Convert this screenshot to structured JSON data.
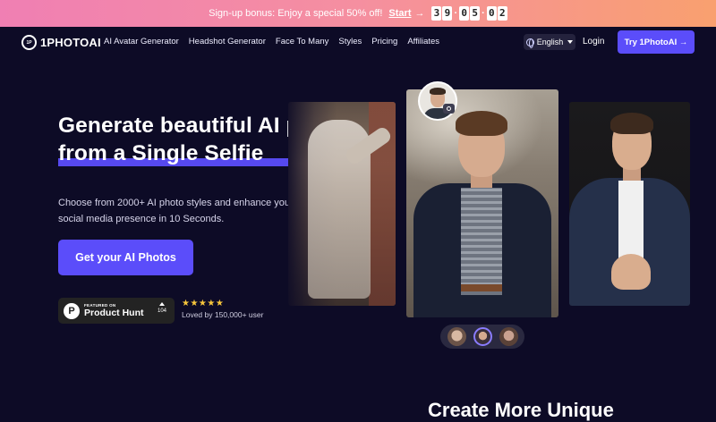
{
  "promo": {
    "text": "Sign-up bonus: Enjoy a special 50% off!",
    "link": "Start",
    "arrow": "→",
    "timer": [
      "3",
      "9",
      "0",
      "5",
      "0",
      "2"
    ]
  },
  "nav": {
    "logo_badge": "1P",
    "logo_text": "1PHOTOAI",
    "links": [
      "AI Avatar Generator",
      "Headshot Generator",
      "Face To Many",
      "Styles",
      "Pricing",
      "Affiliates"
    ],
    "language": "English",
    "login": "Login",
    "cta": "Try 1PhotoAI →"
  },
  "hero": {
    "title_line1": "Generate beautiful AI photos",
    "title_line2": "from a Single Selfie",
    "subtitle": "Choose from 2000+ AI photo styles and enhance your social media presence in 10 Seconds.",
    "cta": "Get your AI Photos",
    "producthunt": {
      "icon": "P",
      "featured": "FEATURED ON",
      "name": "Product Hunt",
      "votes": "104"
    },
    "stars": "★★★★★",
    "loved": "Loved by 150,000+ user"
  },
  "colors": {
    "background": "#0d0b26",
    "accent": "#5b4dfa",
    "star": "#f8c73c"
  },
  "bottom": {
    "heading": "Create More Unique"
  }
}
